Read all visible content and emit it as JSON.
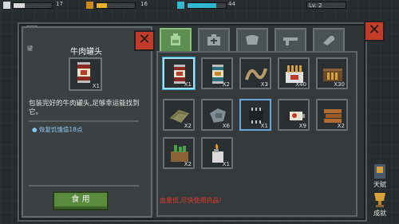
{
  "hud": {
    "health_value": "17",
    "hunger_value": "16",
    "thirst_value": "44",
    "level_label": "Lv. 2",
    "colors": {
      "health": "#d9d9d9",
      "hunger": "#e8b12a",
      "thirst": "#2fb8d0"
    }
  },
  "bag": {
    "title": "背包",
    "corner_tag": "罐"
  },
  "detail": {
    "item_name": "牛肉罐头",
    "count": "X1",
    "description": "包装完好的牛肉罐头,足够幸运能找到它。",
    "effect": "● 恢复饥饿值18点",
    "use_button": "食 用"
  },
  "tabs": [
    {
      "name": "bag-tab",
      "icon": "backpack-icon"
    },
    {
      "name": "medkit-tab",
      "icon": "medkit-icon"
    },
    {
      "name": "armor-tab",
      "icon": "armor-icon"
    },
    {
      "name": "weapon-tab",
      "icon": "gun-icon"
    },
    {
      "name": "tools-tab",
      "icon": "wrench-icon"
    }
  ],
  "slots": [
    {
      "icon": "beef-can-icon",
      "qty": "X1"
    },
    {
      "icon": "fish-can-icon",
      "qty": "X2"
    },
    {
      "icon": "rope-icon",
      "qty": "X3"
    },
    {
      "icon": "ammo-box-icon",
      "qty": "X40"
    },
    {
      "icon": "ammo-crate-icon",
      "qty": "X30"
    },
    {
      "icon": "cloth-icon",
      "qty": "X2"
    },
    {
      "icon": "metal-parts-icon",
      "qty": "X6"
    },
    {
      "icon": "chip-icon",
      "qty": "X1"
    },
    {
      "icon": "battery-icon",
      "qty": "X9"
    },
    {
      "icon": "wood-planks-icon",
      "qty": "X2"
    },
    {
      "icon": "herb-crate-icon",
      "qty": "X2"
    },
    {
      "icon": "lighter-icon",
      "qty": "X1"
    }
  ],
  "warning": "血量低,尽快使用药品!",
  "side_buttons": {
    "talent": "天赋",
    "achievement": "成就"
  }
}
